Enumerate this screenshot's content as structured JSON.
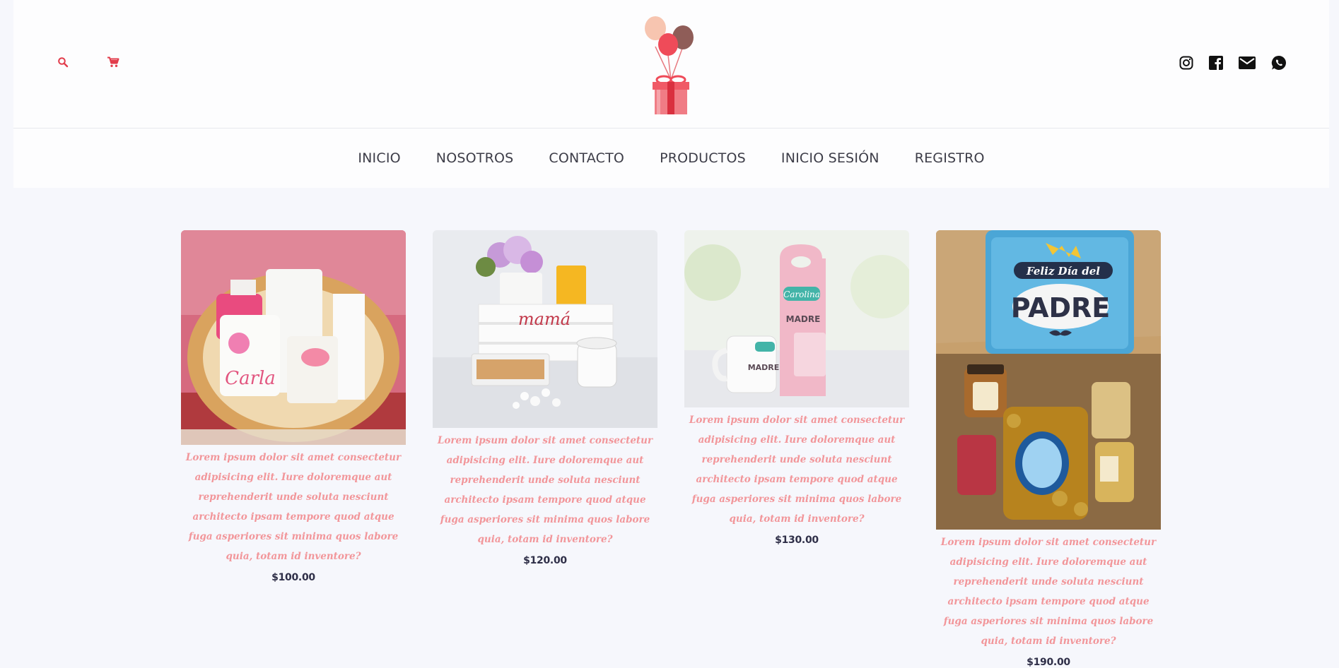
{
  "header": {
    "icons": {
      "search": "search-icon",
      "cart": "cart-icon"
    },
    "logo": "balloons-gift-logo",
    "social": [
      "instagram-icon",
      "facebook-icon",
      "mail-icon",
      "whatsapp-icon"
    ]
  },
  "nav": {
    "items": [
      {
        "label": "INICIO"
      },
      {
        "label": "NOSOTROS"
      },
      {
        "label": "CONTACTO"
      },
      {
        "label": "PRODUCTOS"
      },
      {
        "label": "INICIO SESIÓN"
      },
      {
        "label": "REGISTRO"
      }
    ]
  },
  "products": [
    {
      "description": "Lorem ipsum dolor sit amet consectetur adipisicing elit. Iure doloremque aut reprehenderit unde soluta nesciunt architecto ipsam tempore quod atque fuga asperiores sit minima quos labore quia, totam id inventore?",
      "price": "$100.00",
      "image_text": [
        "Carla"
      ]
    },
    {
      "description": "Lorem ipsum dolor sit amet consectetur adipisicing elit. Iure doloremque aut reprehenderit unde soluta nesciunt architecto ipsam tempore quod atque fuga asperiores sit minima quos labore quia, totam id inventore?",
      "price": "$120.00",
      "image_text": [
        "mamá"
      ]
    },
    {
      "description": "Lorem ipsum dolor sit amet consectetur adipisicing elit. Iure doloremque aut reprehenderit unde soluta nesciunt architecto ipsam tempore quod atque fuga asperiores sit minima quos labore quia, totam id inventore?",
      "price": "$130.00",
      "image_text": [
        "Carolina",
        "MADRE",
        "MADRE"
      ]
    },
    {
      "description": "Lorem ipsum dolor sit amet consectetur adipisicing elit. Iure doloremque aut reprehenderit unde soluta nesciunt architecto ipsam tempore quod atque fuga asperiores sit minima quos labore quia, totam id inventore?",
      "price": "$190.00",
      "image_text": [
        "Feliz Día del",
        "PADRE"
      ]
    }
  ],
  "colors": {
    "accent": "#e23c4b",
    "description": "#f2969a",
    "price": "#2f2f48",
    "nav_text": "#3d3d48",
    "background": "#f6f7fc"
  }
}
